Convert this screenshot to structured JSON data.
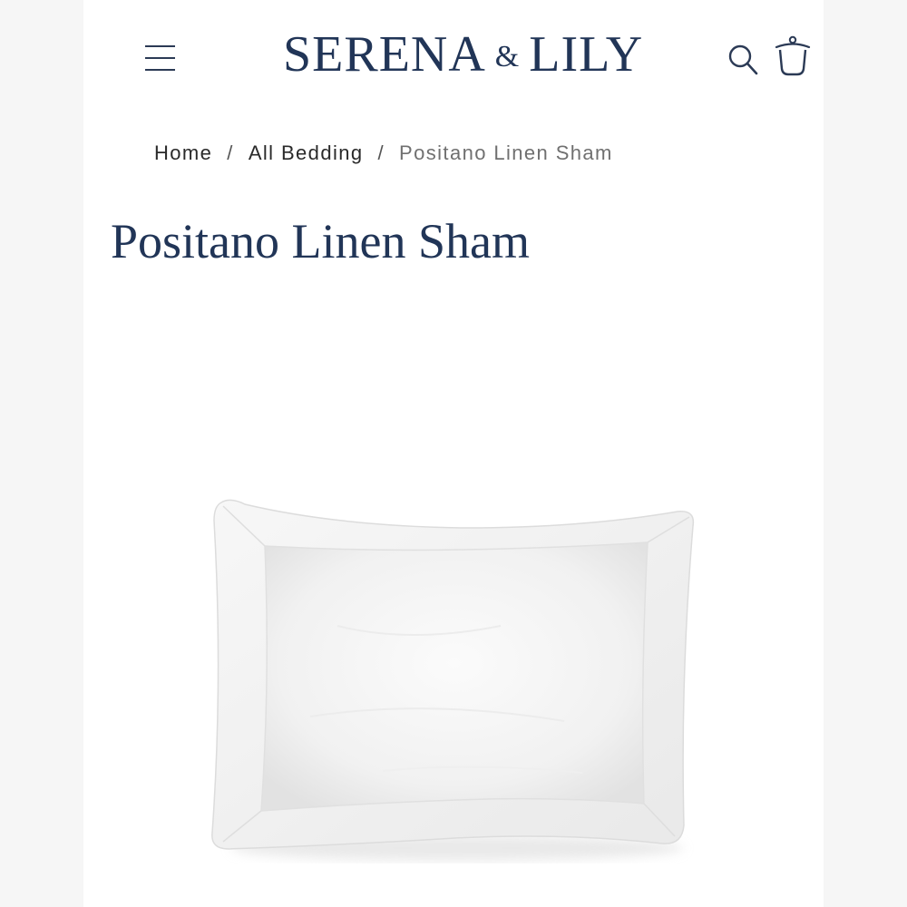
{
  "header": {
    "brand_left": "SERENA",
    "brand_amp": "&",
    "brand_right": "LILY",
    "menu_icon": "hamburger-menu-icon",
    "search_icon": "search-icon",
    "cart_icon": "shopping-bag-icon",
    "brand_color": "#213557"
  },
  "breadcrumb": {
    "items": [
      {
        "label": "Home"
      },
      {
        "label": "All Bedding"
      },
      {
        "label": "Positano Linen Sham"
      }
    ],
    "separator": "/"
  },
  "product": {
    "title": "Positano Linen Sham",
    "image_subject": "white-linen-pillow-sham"
  }
}
